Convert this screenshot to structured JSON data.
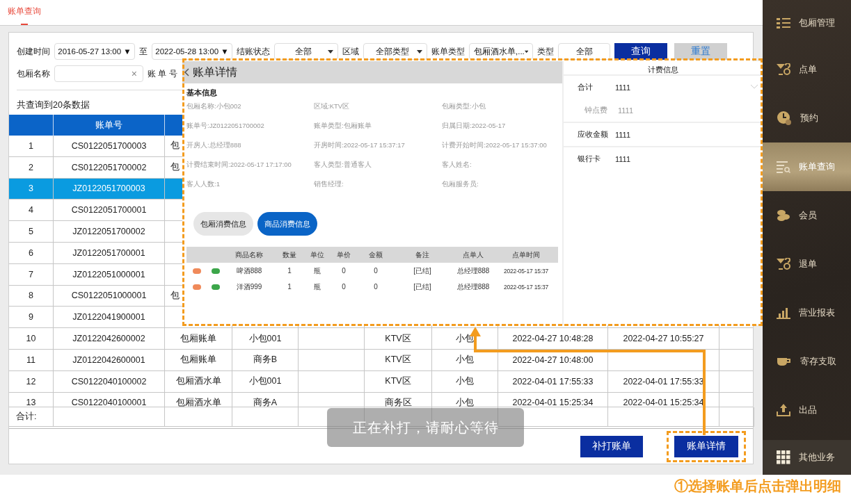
{
  "top_tab": {
    "label": "账单查询",
    "selected": true
  },
  "filters": [
    [
      {
        "kind": "label",
        "text": "创建时间"
      },
      {
        "kind": "date",
        "value": "2016-05-27 13:00 ▼"
      },
      {
        "kind": "label",
        "text": "至"
      },
      {
        "kind": "date",
        "value": "2022-05-28 13:00 ▼"
      },
      {
        "kind": "label",
        "text": "结账状态"
      },
      {
        "kind": "select",
        "value": "全部"
      },
      {
        "kind": "label",
        "text": "区域"
      },
      {
        "kind": "select",
        "value": "全部类型"
      },
      {
        "kind": "label",
        "text": "账单类型"
      },
      {
        "kind": "select",
        "value": "包厢酒水单,..."
      },
      {
        "kind": "label",
        "text": "类型"
      },
      {
        "kind": "field",
        "value": "全部"
      },
      {
        "kind": "primary_button",
        "text": "查询"
      },
      {
        "kind": "secondary_button",
        "text": "重置"
      }
    ],
    [
      {
        "kind": "label",
        "text": "包厢名称"
      },
      {
        "kind": "clear_input",
        "clear": "×"
      },
      {
        "kind": "label",
        "text": "账 单 号"
      }
    ]
  ],
  "count_text": "共查询到20条数据",
  "table": {
    "header": {
      "bill_no": "账单号"
    },
    "rows": [
      {
        "selected": false,
        "cells": [
          "1",
          "CS0122051700003",
          "包"
        ]
      },
      {
        "selected": false,
        "cells": [
          "2",
          "CS0122051700002",
          "包"
        ]
      },
      {
        "selected": true,
        "cells": [
          "3",
          "JZ0122051700003"
        ]
      },
      {
        "selected": false,
        "cells": [
          "4",
          "CS0122051700001"
        ]
      },
      {
        "selected": false,
        "cells": [
          "5",
          "JZ0122051700002"
        ]
      },
      {
        "selected": false,
        "cells": [
          "6",
          "JZ0122051700001"
        ]
      },
      {
        "selected": false,
        "cells": [
          "7",
          "JZ0122051000001"
        ]
      },
      {
        "selected": false,
        "cells": [
          "8",
          "CS0122051000001",
          "包"
        ]
      },
      {
        "selected": false,
        "cells": [
          "9",
          "JZ0122041900001"
        ]
      },
      {
        "selected": false,
        "cells": [
          "10",
          "JZ0122042600002",
          "包厢账单",
          "小包001",
          null,
          "KTV区",
          "小包",
          "2022-04-27 10:48:28",
          "2022-04-27 10:55:27"
        ]
      },
      {
        "selected": false,
        "cells": [
          "11",
          "JZ0122042600001",
          "包厢账单",
          "商务B",
          null,
          "KTV区",
          "小包",
          "2022-04-27 10:48:00"
        ]
      },
      {
        "selected": false,
        "cells": [
          "12",
          "CS0122040100002",
          "包厢酒水单",
          "小包001",
          null,
          "KTV区",
          "小包",
          "2022-04-01 17:55:33",
          "2022-04-01 17:55:33"
        ]
      },
      {
        "selected": false,
        "cells": [
          "13",
          "CS0122040100001",
          "包厢酒水单",
          "商务A",
          null,
          "商务区",
          "小包",
          "2022-04-01 15:25:34",
          "2022-04-01 15:25:34"
        ]
      }
    ],
    "summary_label": "合计:"
  },
  "toast": "正在补打，请耐心等待",
  "actions": [
    {
      "label": "补打账单",
      "highlighted": false
    },
    {
      "label": "账单详情",
      "highlighted": true
    }
  ],
  "detail": {
    "title": "账单详情",
    "section": "基本信息",
    "fields": [
      "包厢名称:小包002",
      "区域:KTV区",
      "包厢类型:小包",
      "账单号:JZ0122051700002",
      "账单类型:包厢账单",
      "归属日期:2022-05-17",
      "开房人:总经理888",
      "开房时间:2022-05-17 15:37:17",
      "计费开始时间:2022-05-17 15:37:00",
      "计费结束时间:2022-05-17 17:17:00",
      "客人类型:普通客人",
      "客人姓名:",
      "客人人数:1",
      "销售经理:",
      "包厢服务员:"
    ],
    "tabs": [
      {
        "label": "包厢消费信息",
        "selected": false
      },
      {
        "label": "商品消费信息",
        "selected": true
      }
    ],
    "goods_columns": [
      "商品名称",
      "数量",
      "单位",
      "单价",
      "金额",
      "备注",
      "点单人",
      "点单时间"
    ],
    "goods_rows": [
      {
        "cells": [
          "啤酒888",
          "1",
          "瓶",
          "0",
          "0",
          "[已结]",
          "总经理888",
          "2022-05-17 15:37"
        ]
      },
      {
        "cells": [
          "洋酒999",
          "1",
          "瓶",
          "0",
          "0",
          "[已结]",
          "总经理888",
          "2022-05-17 15:37"
        ]
      }
    ]
  },
  "billing": {
    "title": "计费信息",
    "rows": [
      {
        "kind": "group",
        "label": "合计",
        "value": "1111"
      },
      {
        "kind": "sub",
        "label": "钟点费",
        "value": "1111"
      },
      {
        "kind": "item",
        "label": "应收金额",
        "value": "1111"
      },
      {
        "kind": "item",
        "label": "银行卡",
        "value": "1111"
      }
    ]
  },
  "sidebar": [
    {
      "label": "包厢管理",
      "selected": false
    },
    {
      "label": "点单",
      "selected": false
    },
    {
      "label": "预约",
      "selected": false
    },
    {
      "label": "账单查询",
      "selected": true
    },
    {
      "label": "会员",
      "selected": false
    },
    {
      "label": "退单",
      "selected": false
    },
    {
      "label": "营业报表",
      "selected": false
    },
    {
      "label": "寄存支取",
      "selected": false
    },
    {
      "label": "出品",
      "selected": false
    },
    {
      "label": "其他业务",
      "selected": false
    }
  ],
  "annotation": "①选择账单后点击弹出明细"
}
